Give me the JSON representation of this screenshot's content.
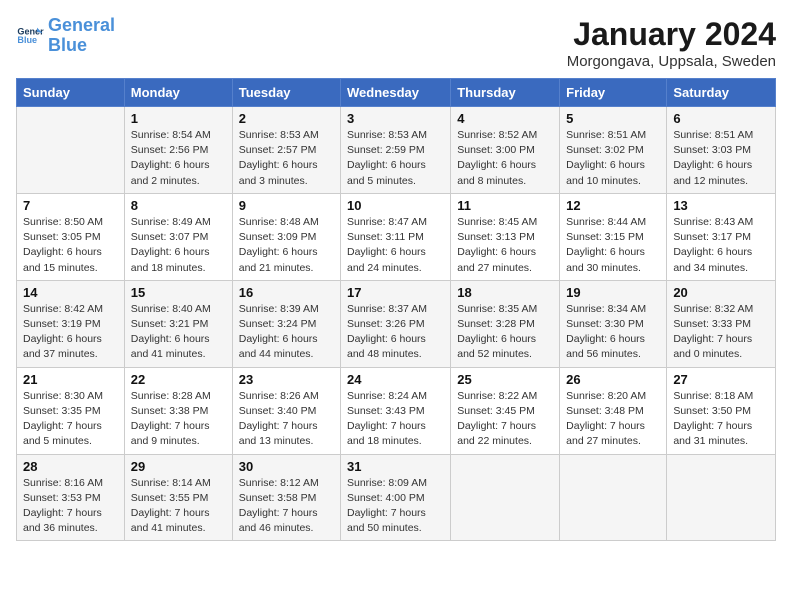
{
  "header": {
    "logo_general": "General",
    "logo_blue": "Blue",
    "month": "January 2024",
    "location": "Morgongava, Uppsala, Sweden"
  },
  "weekdays": [
    "Sunday",
    "Monday",
    "Tuesday",
    "Wednesday",
    "Thursday",
    "Friday",
    "Saturday"
  ],
  "weeks": [
    [
      {
        "day": "",
        "info": ""
      },
      {
        "day": "1",
        "info": "Sunrise: 8:54 AM\nSunset: 2:56 PM\nDaylight: 6 hours\nand 2 minutes."
      },
      {
        "day": "2",
        "info": "Sunrise: 8:53 AM\nSunset: 2:57 PM\nDaylight: 6 hours\nand 3 minutes."
      },
      {
        "day": "3",
        "info": "Sunrise: 8:53 AM\nSunset: 2:59 PM\nDaylight: 6 hours\nand 5 minutes."
      },
      {
        "day": "4",
        "info": "Sunrise: 8:52 AM\nSunset: 3:00 PM\nDaylight: 6 hours\nand 8 minutes."
      },
      {
        "day": "5",
        "info": "Sunrise: 8:51 AM\nSunset: 3:02 PM\nDaylight: 6 hours\nand 10 minutes."
      },
      {
        "day": "6",
        "info": "Sunrise: 8:51 AM\nSunset: 3:03 PM\nDaylight: 6 hours\nand 12 minutes."
      }
    ],
    [
      {
        "day": "7",
        "info": "Sunrise: 8:50 AM\nSunset: 3:05 PM\nDaylight: 6 hours\nand 15 minutes."
      },
      {
        "day": "8",
        "info": "Sunrise: 8:49 AM\nSunset: 3:07 PM\nDaylight: 6 hours\nand 18 minutes."
      },
      {
        "day": "9",
        "info": "Sunrise: 8:48 AM\nSunset: 3:09 PM\nDaylight: 6 hours\nand 21 minutes."
      },
      {
        "day": "10",
        "info": "Sunrise: 8:47 AM\nSunset: 3:11 PM\nDaylight: 6 hours\nand 24 minutes."
      },
      {
        "day": "11",
        "info": "Sunrise: 8:45 AM\nSunset: 3:13 PM\nDaylight: 6 hours\nand 27 minutes."
      },
      {
        "day": "12",
        "info": "Sunrise: 8:44 AM\nSunset: 3:15 PM\nDaylight: 6 hours\nand 30 minutes."
      },
      {
        "day": "13",
        "info": "Sunrise: 8:43 AM\nSunset: 3:17 PM\nDaylight: 6 hours\nand 34 minutes."
      }
    ],
    [
      {
        "day": "14",
        "info": "Sunrise: 8:42 AM\nSunset: 3:19 PM\nDaylight: 6 hours\nand 37 minutes."
      },
      {
        "day": "15",
        "info": "Sunrise: 8:40 AM\nSunset: 3:21 PM\nDaylight: 6 hours\nand 41 minutes."
      },
      {
        "day": "16",
        "info": "Sunrise: 8:39 AM\nSunset: 3:24 PM\nDaylight: 6 hours\nand 44 minutes."
      },
      {
        "day": "17",
        "info": "Sunrise: 8:37 AM\nSunset: 3:26 PM\nDaylight: 6 hours\nand 48 minutes."
      },
      {
        "day": "18",
        "info": "Sunrise: 8:35 AM\nSunset: 3:28 PM\nDaylight: 6 hours\nand 52 minutes."
      },
      {
        "day": "19",
        "info": "Sunrise: 8:34 AM\nSunset: 3:30 PM\nDaylight: 6 hours\nand 56 minutes."
      },
      {
        "day": "20",
        "info": "Sunrise: 8:32 AM\nSunset: 3:33 PM\nDaylight: 7 hours\nand 0 minutes."
      }
    ],
    [
      {
        "day": "21",
        "info": "Sunrise: 8:30 AM\nSunset: 3:35 PM\nDaylight: 7 hours\nand 5 minutes."
      },
      {
        "day": "22",
        "info": "Sunrise: 8:28 AM\nSunset: 3:38 PM\nDaylight: 7 hours\nand 9 minutes."
      },
      {
        "day": "23",
        "info": "Sunrise: 8:26 AM\nSunset: 3:40 PM\nDaylight: 7 hours\nand 13 minutes."
      },
      {
        "day": "24",
        "info": "Sunrise: 8:24 AM\nSunset: 3:43 PM\nDaylight: 7 hours\nand 18 minutes."
      },
      {
        "day": "25",
        "info": "Sunrise: 8:22 AM\nSunset: 3:45 PM\nDaylight: 7 hours\nand 22 minutes."
      },
      {
        "day": "26",
        "info": "Sunrise: 8:20 AM\nSunset: 3:48 PM\nDaylight: 7 hours\nand 27 minutes."
      },
      {
        "day": "27",
        "info": "Sunrise: 8:18 AM\nSunset: 3:50 PM\nDaylight: 7 hours\nand 31 minutes."
      }
    ],
    [
      {
        "day": "28",
        "info": "Sunrise: 8:16 AM\nSunset: 3:53 PM\nDaylight: 7 hours\nand 36 minutes."
      },
      {
        "day": "29",
        "info": "Sunrise: 8:14 AM\nSunset: 3:55 PM\nDaylight: 7 hours\nand 41 minutes."
      },
      {
        "day": "30",
        "info": "Sunrise: 8:12 AM\nSunset: 3:58 PM\nDaylight: 7 hours\nand 46 minutes."
      },
      {
        "day": "31",
        "info": "Sunrise: 8:09 AM\nSunset: 4:00 PM\nDaylight: 7 hours\nand 50 minutes."
      },
      {
        "day": "",
        "info": ""
      },
      {
        "day": "",
        "info": ""
      },
      {
        "day": "",
        "info": ""
      }
    ]
  ]
}
